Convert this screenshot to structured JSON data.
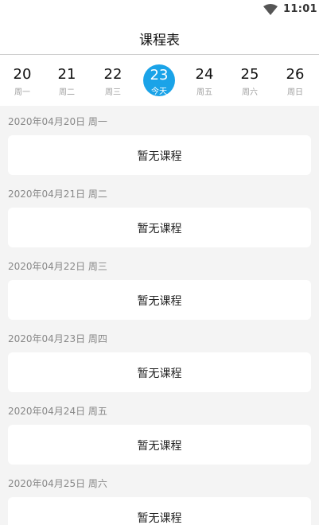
{
  "status_bar": {
    "time": "11:01",
    "wifi_icon": "wifi-icon"
  },
  "header": {
    "title": "课程表"
  },
  "week": [
    {
      "date": "20",
      "weekday": "周一",
      "today": false
    },
    {
      "date": "21",
      "weekday": "周二",
      "today": false
    },
    {
      "date": "22",
      "weekday": "周三",
      "today": false
    },
    {
      "date": "23",
      "weekday": "今天",
      "today": true
    },
    {
      "date": "24",
      "weekday": "周五",
      "today": false
    },
    {
      "date": "25",
      "weekday": "周六",
      "today": false
    },
    {
      "date": "26",
      "weekday": "周日",
      "today": false
    }
  ],
  "days": [
    {
      "heading": "2020年04月20日 周一",
      "message": "暂无课程"
    },
    {
      "heading": "2020年04月21日 周二",
      "message": "暂无课程"
    },
    {
      "heading": "2020年04月22日 周三",
      "message": "暂无课程"
    },
    {
      "heading": "2020年04月23日 周四",
      "message": "暂无课程"
    },
    {
      "heading": "2020年04月24日 周五",
      "message": "暂无课程"
    },
    {
      "heading": "2020年04月25日 周六",
      "message": "暂无课程"
    }
  ],
  "colors": {
    "accent": "#1aa3e8",
    "background": "#f4f4f4"
  }
}
